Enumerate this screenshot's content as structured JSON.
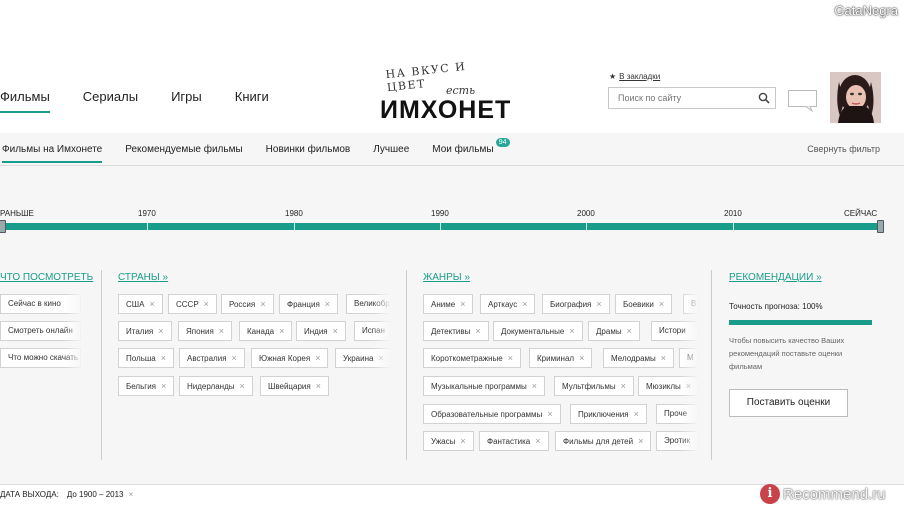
{
  "watermark_top": "GataNegra",
  "topnav": [
    "Фильмы",
    "Сериалы",
    "Игры",
    "Книги"
  ],
  "logo": {
    "slogan": "НА ВКУС И ЦВЕТ",
    "est": "есть",
    "name": "ИМХОНЕТ"
  },
  "bookmark": "В закладки",
  "search": {
    "placeholder": "Поиск по сайту"
  },
  "subnav": {
    "items": [
      "Фильмы на Имхонете",
      "Рекомендуемые фильмы",
      "Новинки фильмов",
      "Лучшее",
      "Мои фильмы"
    ],
    "my_count": "94",
    "collapse": "Свернуть фильтр"
  },
  "timeline": {
    "labels": [
      "РАНЬШЕ",
      "1970",
      "1980",
      "1990",
      "2000",
      "2010",
      "СЕЙЧАС"
    ]
  },
  "filters": {
    "what": {
      "title": "ЧТО ПОСМОТРЕТЬ",
      "chips": [
        "Сейчас в кино",
        "Смотреть онлайн",
        "Что можно скачать"
      ]
    },
    "countries": {
      "title": "СТРАНЫ",
      "rows": [
        [
          "США",
          "СССР",
          "Россия",
          "Франция",
          "Великобр"
        ],
        [
          "Италия",
          "Япония",
          "Канада",
          "Индия",
          "Испан"
        ],
        [
          "Польша",
          "Австралия",
          "Южная Корея",
          "Украина"
        ],
        [
          "Бельгия",
          "Нидерланды",
          "Швейцария"
        ]
      ]
    },
    "genres": {
      "title": "ЖАНРЫ",
      "rows": [
        [
          "Аниме",
          "Арткаус",
          "Биография",
          "Боевики",
          "В"
        ],
        [
          "Детективы",
          "Документальные",
          "Драмы",
          "Истори"
        ],
        [
          "Короткометражные",
          "Криминал",
          "Мелодрамы",
          "М"
        ],
        [
          "Музыкальные программы",
          "Мультфильмы",
          "Мюзиклы"
        ],
        [
          "Образовательные программы",
          "Приключения",
          "Проче"
        ],
        [
          "Ужасы",
          "Фантастика",
          "Фильмы для детей",
          "Эротик"
        ]
      ]
    },
    "reco": {
      "title": "РЕКОМЕНДАЦИИ",
      "accuracy": "Точность прогноза: 100%",
      "accuracy_value": 100,
      "desc": "Чтобы повысить качество Ваших рекомендаций поставьте оценки фильмам",
      "button": "Поставить оценки"
    }
  },
  "release": {
    "label": "ДАТА ВЫХОДА:",
    "value": "До 1900 – 2013"
  },
  "watermark_bottom": "Recommend.ru",
  "colors": {
    "accent": "#1a9c8a",
    "count_badge": "#27a89a"
  }
}
